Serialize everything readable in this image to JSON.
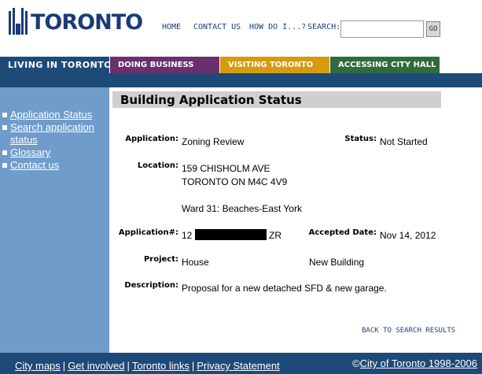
{
  "header": {
    "logo_text": "TORONTO",
    "nav": {
      "home": "HOME",
      "contact": "CONTACT US",
      "how": "HOW DO I...?",
      "search_label": "SEARCH:",
      "search_value": "",
      "go": "GO"
    }
  },
  "tabs": {
    "living": "LIVING IN TORONTO",
    "business": "DOING BUSINESS",
    "visiting": "VISITING TORONTO",
    "cityhall": "ACCESSING CITY HALL"
  },
  "sidebar": {
    "items": [
      {
        "label": "Application Status"
      },
      {
        "label": "Search application status"
      },
      {
        "label": "Glossary"
      },
      {
        "label": "Contact us"
      }
    ]
  },
  "main": {
    "title": "Building Application Status",
    "labels": {
      "application": "Application:",
      "status": "Status:",
      "location": "Location:",
      "app_num": "Application#:",
      "accepted": "Accepted Date:",
      "project": "Project:",
      "description": "Description:"
    },
    "values": {
      "application": "Zoning Review",
      "status": "Not Started",
      "location_line1": "159 CHISHOLM AVE",
      "location_line2": "TORONTO  ON  M4C 4V9",
      "ward": "Ward 31: Beaches-East York",
      "app_num_prefix": "12",
      "app_num_suffix": "ZR",
      "accepted_date": "Nov 14, 2012",
      "project_type": "House",
      "project_work": "New Building",
      "description": "Proposal for a new detached SFD & new garage."
    },
    "back_link": "BACK TO SEARCH RESULTS"
  },
  "footer": {
    "links": [
      "City maps",
      "Get involved",
      "Toronto links",
      "Privacy Statement"
    ],
    "copyright_symbol": "©",
    "copyright_link": "City of Toronto 1998-2006"
  },
  "colors": {
    "navy": "#1e4a78",
    "purple": "#6a2f6e",
    "gold": "#d69b0c",
    "green": "#2f6b3b",
    "sidebar": "#6f9ccb"
  }
}
